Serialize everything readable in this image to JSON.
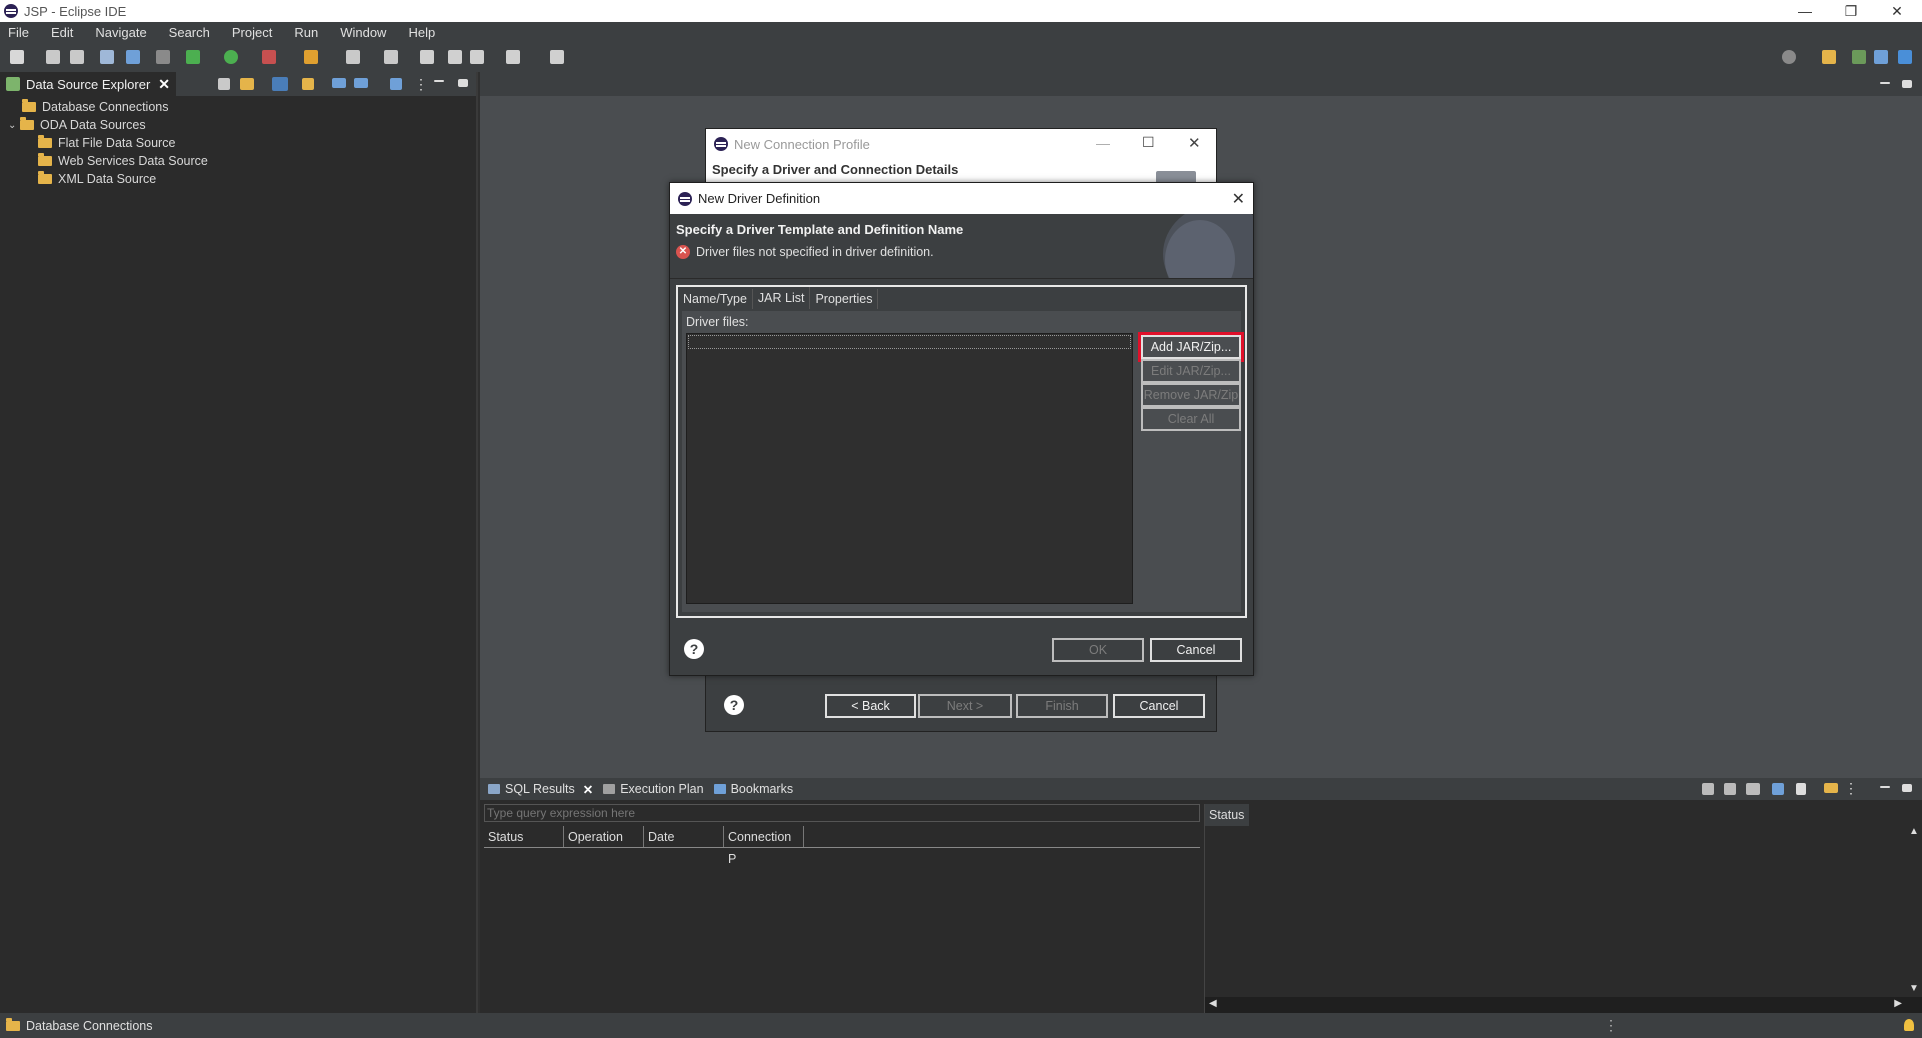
{
  "window": {
    "title": "JSP - Eclipse IDE",
    "minimize": "—",
    "restore": "❐",
    "close": "✕"
  },
  "menu": [
    "File",
    "Edit",
    "Navigate",
    "Search",
    "Project",
    "Run",
    "Window",
    "Help"
  ],
  "left_view": {
    "tab_label": "Data Source Explorer",
    "close": "✕",
    "tree": [
      {
        "label": "Database Connections",
        "indent": 0,
        "expander": ""
      },
      {
        "label": "ODA Data Sources",
        "indent": 0,
        "expander": "⌄"
      },
      {
        "label": "Flat File Data Source",
        "indent": 1,
        "expander": ""
      },
      {
        "label": "Web Services Data Source",
        "indent": 1,
        "expander": ""
      },
      {
        "label": "XML Data Source",
        "indent": 1,
        "expander": ""
      }
    ]
  },
  "bg_dialog": {
    "title": "New Connection Profile",
    "header": "Specify a Driver and Connection Details",
    "back": "< Back",
    "next": "Next >",
    "finish": "Finish",
    "cancel": "Cancel",
    "help": "?",
    "min": "—",
    "max": "☐",
    "close": "✕"
  },
  "dialog": {
    "title": "New Driver Definition",
    "close": "✕",
    "banner_title": "Specify a Driver Template and Definition Name",
    "error_message": "Driver files not specified in driver definition.",
    "error_glyph": "✕",
    "tabs": [
      "Name/Type",
      "JAR List",
      "Properties"
    ],
    "active_tab": "JAR List",
    "driver_files_label": "Driver files:",
    "buttons": {
      "add": "Add JAR/Zip...",
      "edit": "Edit JAR/Zip...",
      "remove": "Remove JAR/Zip",
      "clear": "Clear All"
    },
    "ok": "OK",
    "cancel": "Cancel",
    "help": "?"
  },
  "bottom": {
    "tabs": [
      {
        "label": "SQL Results",
        "closable": true
      },
      {
        "label": "Execution Plan",
        "closable": false
      },
      {
        "label": "Bookmarks",
        "closable": false
      }
    ],
    "close": "✕",
    "query_placeholder": "Type query expression here",
    "columns": [
      "Status",
      "Operation",
      "Date",
      "Connection P"
    ],
    "status_header": "Status"
  },
  "statusbar": {
    "message": "Database Connections"
  },
  "colors": {
    "highlight": "#e0102a",
    "folder": "#e5b44a",
    "error": "#d9534f"
  }
}
